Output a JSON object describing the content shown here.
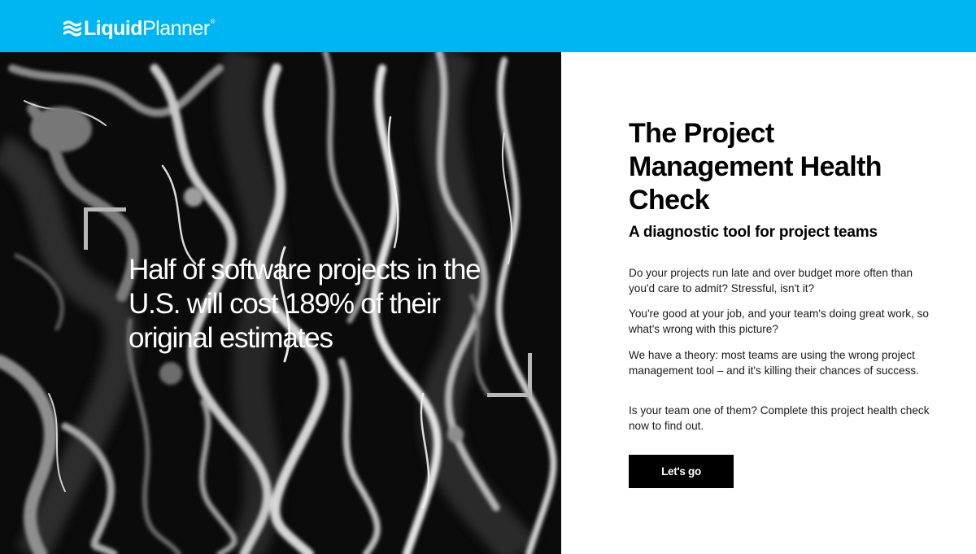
{
  "header": {
    "brand_bold": "Liquid",
    "brand_regular": "Planner",
    "brand_mark": "®",
    "logo_icon": "liquidplanner-wave-logo",
    "background_color": "#00b6f2"
  },
  "hero": {
    "quote": "Half of software projects in the U.S. will cost 189% of their original estimates",
    "background_image": "black-and-white-marble-texture"
  },
  "content": {
    "title": "The Project Management Health Check",
    "subtitle": "A diagnostic tool for project teams",
    "paragraphs": [
      "Do your projects run late and over budget more often than you'd care to admit? Stressful, isn't it?",
      "You're good at your job, and your team's doing great work, so what's wrong with this picture?",
      "We have a theory: most teams are using the wrong project management tool – and it's killing their chances of success.",
      "Is your team one of them? Complete this project health check now to find out."
    ],
    "cta_label": "Let's go"
  }
}
